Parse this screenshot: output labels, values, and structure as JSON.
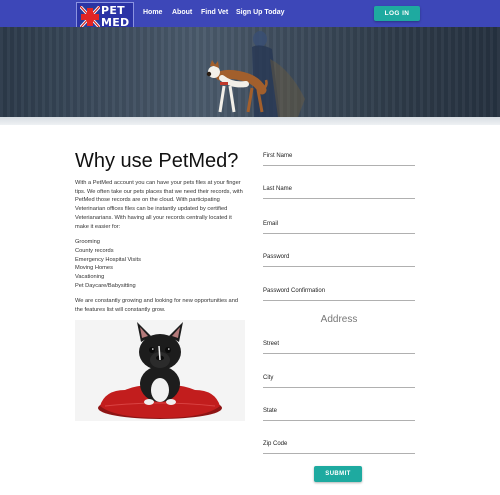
{
  "brand": {
    "logo_line1": "PET",
    "logo_line2": "MED",
    "logo_icon": "red-cross-on-flag-icon"
  },
  "nav": {
    "links": [
      "Home",
      "About",
      "Find Vet",
      "Sign Up Today"
    ],
    "login_label": "LOG IN"
  },
  "hero": {
    "image": "dog-walking-with-owner-photo"
  },
  "content": {
    "title": "Why use PetMed?",
    "paragraph1": "With a PetMed account you can have your pets files at your finger tips. We often take our pets places that we need their records, with PetMed those records are on the cloud. With participating Veterinarian offices files can be instantly updated by certified Veterianarians. With having all your records centrally located it make it easier for:",
    "features": [
      "Grooming",
      "County records",
      "Emergency Hospital Visits",
      "Moving Homes",
      "Vacationing",
      "Pet Daycare/Babysitting"
    ],
    "paragraph2": "We are constantly growing and looking for new opportunities and the features list will constantly grow.",
    "photo": "french-bulldog-on-red-cushion-photo"
  },
  "form": {
    "first_name": "First Name",
    "last_name": "Last Name",
    "email": "Email",
    "password": "Password",
    "password_confirmation": "Password Confirmation",
    "address_heading": "Address",
    "street": "Street",
    "city": "City",
    "state": "State",
    "zip": "Zip Code",
    "submit_label": "SUBMIT"
  },
  "colors": {
    "navbar": "#3d47b8",
    "accent": "#1eaaa0"
  }
}
